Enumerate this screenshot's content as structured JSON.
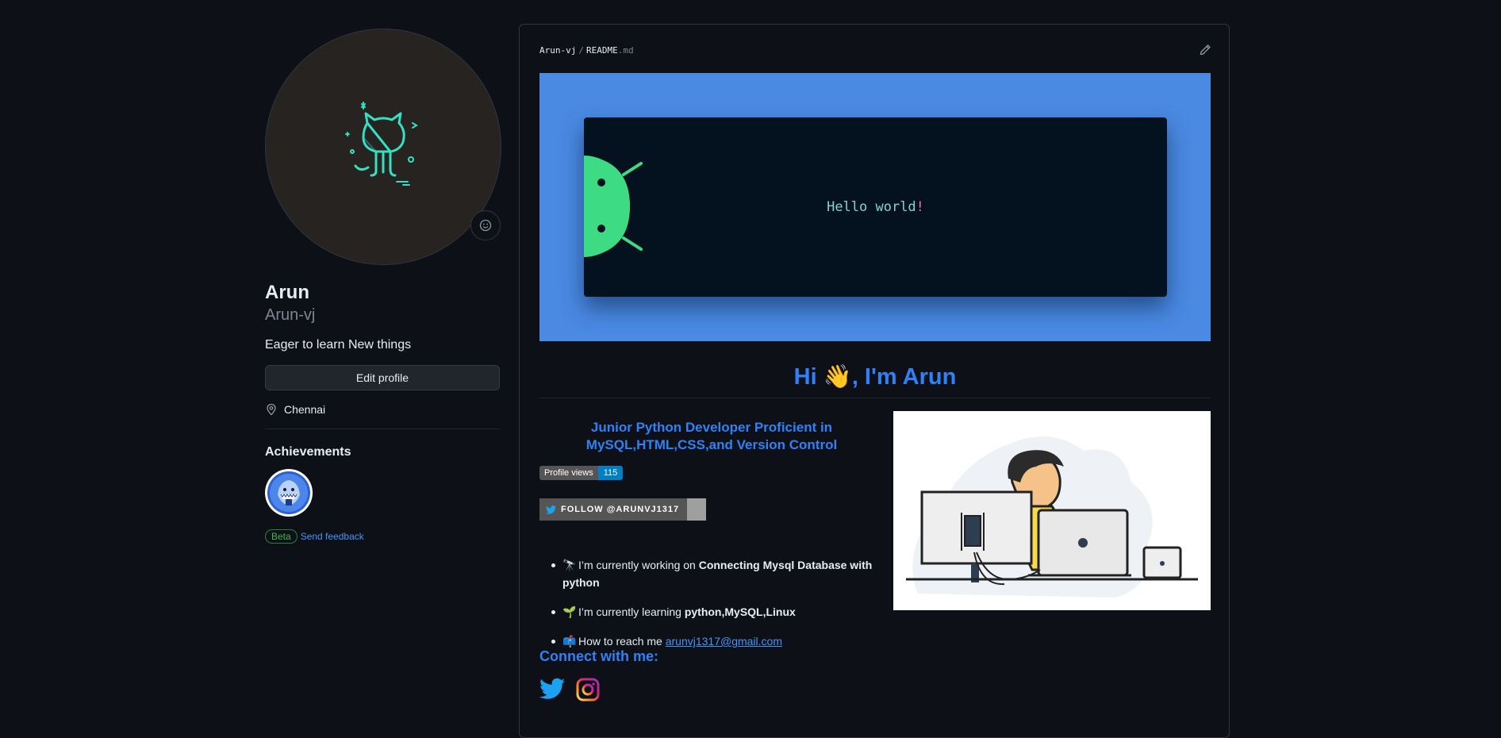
{
  "profile": {
    "display_name": "Arun",
    "username": "Arun-vj",
    "bio": "Eager to learn New things",
    "edit_button": "Edit profile",
    "location": "Chennai",
    "achievements_title": "Achievements",
    "beta_label": "Beta",
    "send_feedback": "Send feedback"
  },
  "readme": {
    "path_user": "Arun-vj",
    "path_sep": "/",
    "path_file": "README",
    "path_ext": ".md",
    "banner_text": "Hello world",
    "banner_bang": "!",
    "greeting": "Hi 👋, I'm Arun",
    "tagline": "Junior Python Developer Proficient in MySQL,HTML,CSS,and Version Control",
    "views_label": "Profile views",
    "views_count": "115",
    "follow_label": "FOLLOW @ARUNVJ1317",
    "bullets": [
      {
        "emoji": "🔭",
        "text": "I’m currently working on ",
        "bold": "Connecting Mysql Database with python"
      },
      {
        "emoji": "🌱",
        "text": "I’m currently learning ",
        "bold": "python,MySQL,Linux"
      },
      {
        "emoji": "📫",
        "text": "How to reach me ",
        "link": "arunvj1317@gmail.com"
      }
    ],
    "connect_title": "Connect with me:"
  },
  "colors": {
    "accent": "#2f81f7",
    "banner_bg": "#4a8ae3",
    "terminal_bg": "#04121f",
    "android_green": "#3ddc84"
  }
}
